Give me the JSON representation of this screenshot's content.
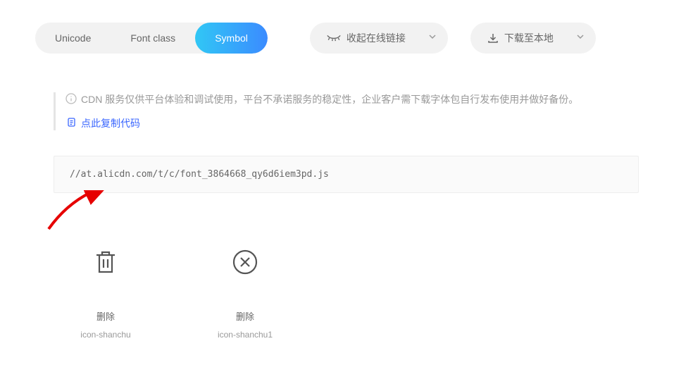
{
  "tabs": {
    "unicode": "Unicode",
    "fontclass": "Font class",
    "symbol": "Symbol"
  },
  "actions": {
    "collapse": "收起在线链接",
    "download": "下载至本地"
  },
  "notice": {
    "text": "CDN 服务仅供平台体验和调试使用，平台不承诺服务的稳定性，企业客户需下载字体包自行发布使用并做好备份。",
    "copy": "点此复制代码"
  },
  "code": "//at.alicdn.com/t/c/font_3864668_qy6d6iem3pd.js",
  "icons": {
    "delete1": {
      "cn": "删除",
      "en": "icon-shanchu"
    },
    "delete2": {
      "cn": "删除",
      "en": "icon-shanchu1"
    }
  }
}
